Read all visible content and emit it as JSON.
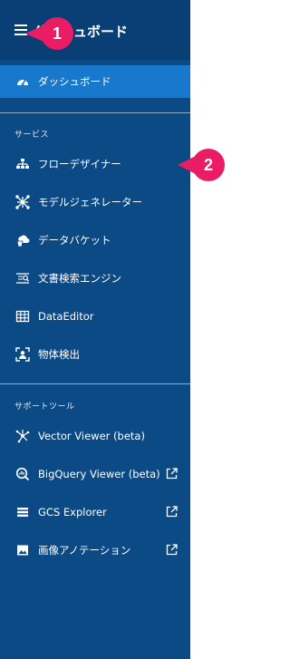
{
  "header": {
    "title": "ダッシュボード"
  },
  "dashboard_item": {
    "label": "ダッシュボード",
    "icon": "dashboard-gauge-icon"
  },
  "services_section": {
    "label": "サービス",
    "items": [
      {
        "label": "フローデザイナー",
        "icon": "flow-hierarchy-icon"
      },
      {
        "label": "モデルジェネレーター",
        "icon": "model-network-icon"
      },
      {
        "label": "データバケット",
        "icon": "bucket-cloud-icon"
      },
      {
        "label": "文書検索エンジン",
        "icon": "document-search-icon"
      },
      {
        "label": "DataEditor",
        "icon": "table-grid-icon"
      },
      {
        "label": "物体検出",
        "icon": "object-detection-icon"
      }
    ]
  },
  "support_section": {
    "label": "サポートツール",
    "items": [
      {
        "label": "Vector Viewer (beta)",
        "icon": "vector-scatter-icon",
        "external": false
      },
      {
        "label": "BigQuery Viewer (beta)",
        "icon": "bigquery-icon",
        "external": true
      },
      {
        "label": "GCS Explorer",
        "icon": "storage-list-icon",
        "external": true
      },
      {
        "label": "画像アノテーション",
        "icon": "image-icon",
        "external": true
      }
    ]
  },
  "callouts": [
    {
      "number": "1"
    },
    {
      "number": "2"
    }
  ],
  "colors": {
    "sidebar": "#0c4a85",
    "header": "#0a3f76",
    "active": "#1878cb",
    "badge": "#ea1c63"
  }
}
